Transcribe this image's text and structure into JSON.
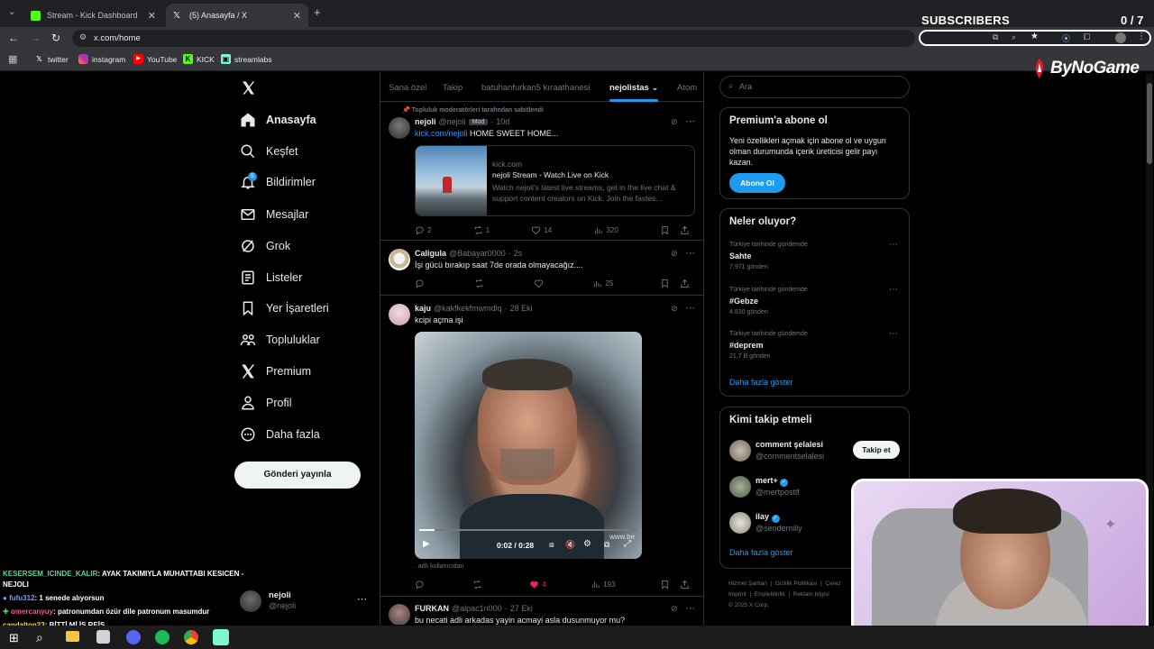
{
  "browser": {
    "tabs": [
      {
        "title": "Stream - Kick Dashboard"
      },
      {
        "title": "(5) Anasayfa / X"
      }
    ],
    "url": "x.com/home",
    "bookmarks": [
      "twitter",
      "instagram",
      "YouTube",
      "KICK",
      "streamlabs"
    ]
  },
  "overlay": {
    "subscribers_label": "SUBSCRIBERS",
    "subscribers_count": "0 / 7",
    "brand": "ByNoGame",
    "chat": [
      {
        "user": "KESERSEM_ICINDE_KALIR",
        "msg": ": AYAK TAKIMIYLA MUHATTABI KESICEN - NEJOLI",
        "color": "#4dd8a0"
      },
      {
        "user": "fufu312",
        "msg": ": 1 senede alıyorsun",
        "color": "#7b9cff"
      },
      {
        "user": "omercanyuy",
        "msg": ": patronumdan özür dile patronum masumdur",
        "color": "#ff4fa0"
      },
      {
        "user": "candalton23",
        "msg": ": BİTTİ Mİ İŞ REİS",
        "color": "#ffd24d"
      }
    ]
  },
  "sidebar": {
    "items": [
      {
        "label": "Anasayfa",
        "icon": "home-icon"
      },
      {
        "label": "Keşfet",
        "icon": "search-icon"
      },
      {
        "label": "Bildirimler",
        "icon": "bell-icon"
      },
      {
        "label": "Mesajlar",
        "icon": "mail-icon"
      },
      {
        "label": "Grok",
        "icon": "grok-icon"
      },
      {
        "label": "Listeler",
        "icon": "list-icon"
      },
      {
        "label": "Yer İşaretleri",
        "icon": "bookmark-icon"
      },
      {
        "label": "Topluluklar",
        "icon": "people-icon"
      },
      {
        "label": "Premium",
        "icon": "x-icon"
      },
      {
        "label": "Profil",
        "icon": "person-icon"
      },
      {
        "label": "Daha fazla",
        "icon": "more-icon"
      }
    ],
    "notification_badge": "5",
    "post_button": "Gönderi yayınla",
    "account": {
      "name": "nejoli",
      "handle": "@nejoli"
    }
  },
  "feed": {
    "tabs": [
      "Sana özel",
      "Takip",
      "batuhanfurkan5 kıraathanesi",
      "nejolistas",
      "Atom"
    ],
    "active_tab": "nejolistas",
    "tweets": [
      {
        "pinned": "Topluluk moderatörleri tarafından sabitlendi",
        "name": "nejoli",
        "handle": "@nejoli",
        "badge": "Mod",
        "time": "10d",
        "link": "kick.com/nejoli",
        "text": "HOME SWEET HOME...",
        "card": {
          "domain": "kick.com",
          "title": "nejoli Stream - Watch Live on Kick",
          "desc": "Watch nejoli's latest live streams, get in the live chat & support content creators on Kick. Join the fastes..."
        },
        "stats": {
          "replies": "2",
          "reposts": "1",
          "likes": "14",
          "views": "320"
        }
      },
      {
        "name": "Caligula",
        "handle": "@Babayar0000",
        "time": "2s",
        "text": "İşi gücü bırakıp saat 7de orada olmayacağız....",
        "stats": {
          "replies": "",
          "reposts": "",
          "likes": "",
          "views": "25"
        }
      },
      {
        "name": "kaju",
        "handle": "@kakfkekfmwmdlq",
        "time": "28 Eki",
        "text": "kcipi açma işi",
        "video": {
          "time": "0:02 / 0:28",
          "watermark": "www.be"
        },
        "caption": ". adlı kullanıcıdan",
        "stats": {
          "replies": "",
          "reposts": "",
          "likes": "4",
          "views": "193"
        }
      },
      {
        "name": "FURKAN",
        "handle": "@alpac1n000",
        "time": "27 Eki",
        "text": "bu necati adli arkadas yayin acmayi asla dusunmuyor mu?"
      }
    ]
  },
  "right": {
    "search_placeholder": "Ara",
    "premium": {
      "title": "Premium'a abone ol",
      "text": "Yeni özellikleri açmak için abone ol ve uygun olman durumunda içerik üreticisi gelir payı kazan.",
      "button": "Abone Ol"
    },
    "trends": {
      "title": "Neler oluyor?",
      "items": [
        {
          "context": "Türkiye tarihinde gündemde",
          "tag": "Sahte",
          "count": "7.971 gönderi"
        },
        {
          "context": "Türkiye tarihinde gündemde",
          "tag": "#Gebze",
          "count": "4.830 gönderi"
        },
        {
          "context": "Türkiye tarihinde gündemde",
          "tag": "#deprem",
          "count": "21,7 B gönderi"
        }
      ],
      "more": "Daha fazla göster"
    },
    "who": {
      "title": "Kimi takip etmeli",
      "items": [
        {
          "name": "comment şelalesi",
          "handle": "@commentselalesi",
          "verified": false
        },
        {
          "name": "mert+",
          "handle": "@mertpostlf",
          "verified": true
        },
        {
          "name": "ilay",
          "handle": "@sendemilly",
          "verified": true
        }
      ],
      "follow": "Takip et",
      "more": "Daha fazla göster"
    },
    "footer": [
      "Hizmet Şartları",
      "Gizlilik Politikası",
      "Çerez",
      "Imprint",
      "Erişilebilirlik",
      "Reklam bilgisi",
      "© 2025 X Corp."
    ]
  }
}
